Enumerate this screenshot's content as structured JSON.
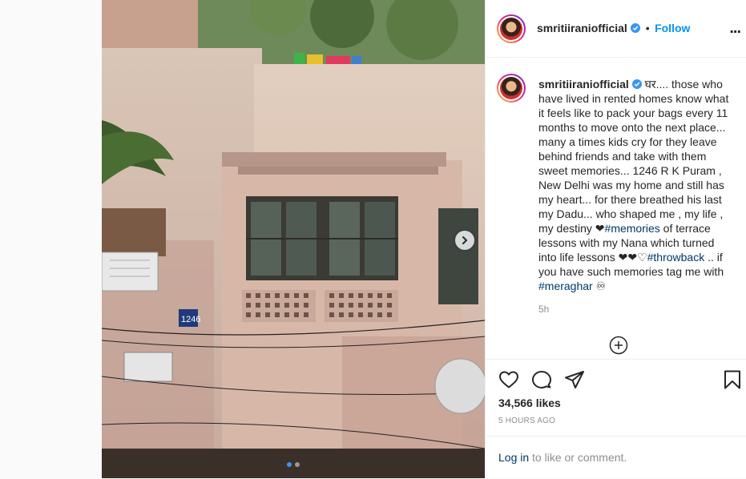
{
  "post": {
    "username": "smritiiraniofficial",
    "follow_separator": "•",
    "follow_label": "Follow",
    "more_label": "...",
    "caption_parts": {
      "p1": "घर.... those who have lived in rented homes know what it feels like to pack your bags every 11 months to move onto the next place... many a times kids cry for they leave behind friends and take with them sweet memories... 1246 R K Puram , New Delhi was my home and still has my heart... for there breathed his last my Dadu... who shaped me , my life , my destiny ❤",
      "tag1": "#memories",
      "p2": " of terrace lessons with my Nana which turned into life lessons ❤❤♡",
      "tag2": "#throwback",
      "p3": " .. if you have such memories tag me with ",
      "tag3": "#meraghar",
      "p4": " ♾"
    },
    "time_ago": "5h",
    "likes": "34,566 likes",
    "posted": "5 HOURS AGO",
    "login_link": "Log in",
    "login_rest": " to like or comment.",
    "carousel": {
      "slides": 2,
      "active": 1
    },
    "house_number": "1246"
  },
  "colors": {
    "accent": "#0095f6",
    "hashtag": "#00376b",
    "muted": "#8e8e8e",
    "text": "#262626"
  },
  "icons": [
    "verified-badge-icon",
    "more-options-icon",
    "chevron-right-icon",
    "add-circle-icon",
    "heart-icon",
    "comment-icon",
    "share-icon",
    "bookmark-icon"
  ]
}
